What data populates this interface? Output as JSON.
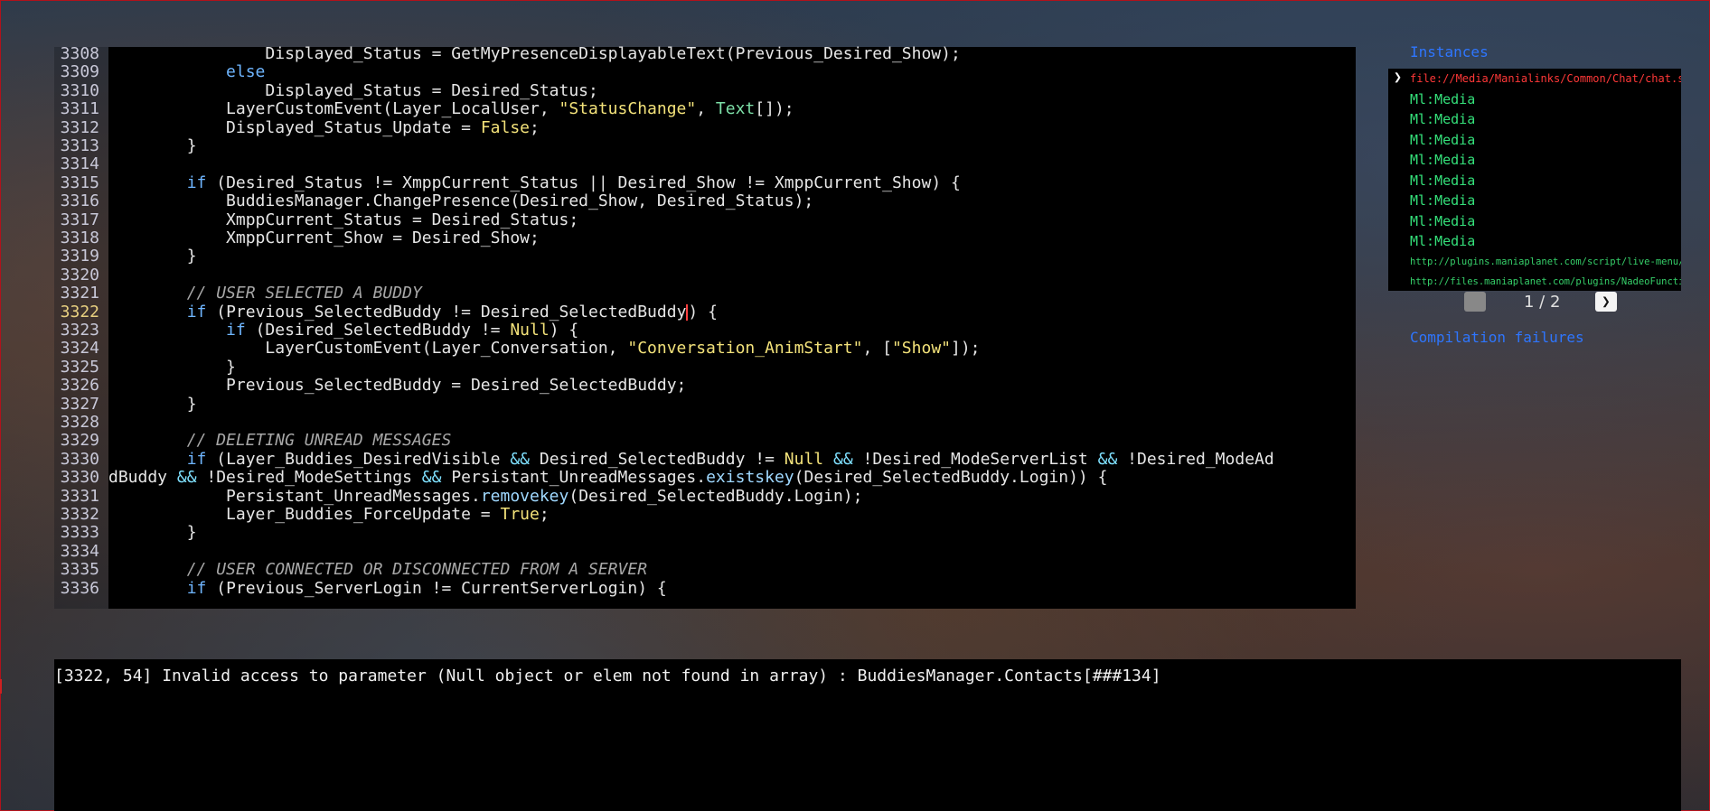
{
  "code": {
    "lines": [
      {
        "n": "3308",
        "segs": [
          {
            "t": "                Displayed_Status = GetMyPresenceDisplayableText(Previous_Desired_Show);",
            "c": "src"
          }
        ]
      },
      {
        "n": "3309",
        "segs": [
          {
            "t": "            ",
            "c": "src"
          },
          {
            "t": "else",
            "c": "kw"
          }
        ]
      },
      {
        "n": "3310",
        "segs": [
          {
            "t": "                Displayed_Status = Desired_Status;",
            "c": "src"
          }
        ]
      },
      {
        "n": "3311",
        "segs": [
          {
            "t": "            LayerCustomEvent(Layer_LocalUser, ",
            "c": "src"
          },
          {
            "t": "\"StatusChange\"",
            "c": "str"
          },
          {
            "t": ", ",
            "c": "src"
          },
          {
            "t": "Text",
            "c": "type"
          },
          {
            "t": "[]);",
            "c": "src"
          }
        ]
      },
      {
        "n": "3312",
        "segs": [
          {
            "t": "            Displayed_Status_Update = ",
            "c": "src"
          },
          {
            "t": "False",
            "c": "bool"
          },
          {
            "t": ";",
            "c": "src"
          }
        ]
      },
      {
        "n": "3313",
        "segs": [
          {
            "t": "        }",
            "c": "src"
          }
        ]
      },
      {
        "n": "3314",
        "segs": [
          {
            "t": "",
            "c": "src"
          }
        ]
      },
      {
        "n": "3315",
        "segs": [
          {
            "t": "        ",
            "c": "src"
          },
          {
            "t": "if",
            "c": "kw"
          },
          {
            "t": " (Desired_Status != XmppCurrent_Status || Desired_Show != XmppCurrent_Show) {",
            "c": "src"
          }
        ]
      },
      {
        "n": "3316",
        "segs": [
          {
            "t": "            BuddiesManager.ChangePresence(Desired_Show, Desired_Status);",
            "c": "src"
          }
        ]
      },
      {
        "n": "3317",
        "segs": [
          {
            "t": "            XmppCurrent_Status = Desired_Status;",
            "c": "src"
          }
        ]
      },
      {
        "n": "3318",
        "segs": [
          {
            "t": "            XmppCurrent_Show = Desired_Show;",
            "c": "src"
          }
        ]
      },
      {
        "n": "3319",
        "segs": [
          {
            "t": "        }",
            "c": "src"
          }
        ]
      },
      {
        "n": "3320",
        "segs": [
          {
            "t": "",
            "c": "src"
          }
        ]
      },
      {
        "n": "3321",
        "segs": [
          {
            "t": "        // USER SELECTED A BUDDY",
            "c": "cmt"
          }
        ]
      },
      {
        "n": "3322",
        "segs": [
          {
            "t": "        ",
            "c": "src"
          },
          {
            "t": "if",
            "c": "kw"
          },
          {
            "t": " (Previous_SelectedBuddy != Desired_SelectedBuddy",
            "c": "src"
          },
          {
            "t": "caret",
            "c": "caret"
          },
          {
            "t": ") {",
            "c": "src"
          }
        ]
      },
      {
        "n": "3323",
        "segs": [
          {
            "t": "            ",
            "c": "src"
          },
          {
            "t": "if",
            "c": "kw"
          },
          {
            "t": " (Desired_SelectedBuddy != ",
            "c": "src"
          },
          {
            "t": "Null",
            "c": "bool"
          },
          {
            "t": ") {",
            "c": "src"
          }
        ]
      },
      {
        "n": "3324",
        "segs": [
          {
            "t": "                LayerCustomEvent(Layer_Conversation, ",
            "c": "src"
          },
          {
            "t": "\"Conversation_AnimStart\"",
            "c": "str"
          },
          {
            "t": ", [",
            "c": "src"
          },
          {
            "t": "\"Show\"",
            "c": "str"
          },
          {
            "t": "]);",
            "c": "src"
          }
        ]
      },
      {
        "n": "3325",
        "segs": [
          {
            "t": "            }",
            "c": "src"
          }
        ]
      },
      {
        "n": "3326",
        "segs": [
          {
            "t": "            Previous_SelectedBuddy = Desired_SelectedBuddy;",
            "c": "src"
          }
        ]
      },
      {
        "n": "3327",
        "segs": [
          {
            "t": "        }",
            "c": "src"
          }
        ]
      },
      {
        "n": "3328",
        "segs": [
          {
            "t": "",
            "c": "src"
          }
        ]
      },
      {
        "n": "3329",
        "segs": [
          {
            "t": "        // DELETING UNREAD MESSAGES",
            "c": "cmt"
          }
        ]
      },
      {
        "n": "3330",
        "segs": [
          {
            "t": "        ",
            "c": "src"
          },
          {
            "t": "if",
            "c": "kw"
          },
          {
            "t": " (Layer_Buddies_DesiredVisible ",
            "c": "src"
          },
          {
            "t": "&&",
            "c": "op"
          },
          {
            "t": " Desired_SelectedBuddy != ",
            "c": "src"
          },
          {
            "t": "Null",
            "c": "bool"
          },
          {
            "t": " ",
            "c": "src"
          },
          {
            "t": "&&",
            "c": "op"
          },
          {
            "t": " !Desired_ModeServerList ",
            "c": "src"
          },
          {
            "t": "&&",
            "c": "op"
          },
          {
            "t": " !Desired_ModeAd",
            "c": "src"
          }
        ]
      },
      {
        "n": "3330",
        "segs": [
          {
            "t": "dBuddy ",
            "c": "src"
          },
          {
            "t": "&&",
            "c": "op"
          },
          {
            "t": " !Desired_ModeSettings ",
            "c": "src"
          },
          {
            "t": "&&",
            "c": "op"
          },
          {
            "t": " Persistant_UnreadMessages.",
            "c": "src"
          },
          {
            "t": "existskey",
            "c": "fn"
          },
          {
            "t": "(Desired_SelectedBuddy.Login)) {",
            "c": "src"
          }
        ],
        "wrap": true
      },
      {
        "n": "3331",
        "segs": [
          {
            "t": "            Persistant_UnreadMessages.",
            "c": "src"
          },
          {
            "t": "removekey",
            "c": "fn"
          },
          {
            "t": "(Desired_SelectedBuddy.Login);",
            "c": "src"
          }
        ]
      },
      {
        "n": "3332",
        "segs": [
          {
            "t": "            Layer_Buddies_ForceUpdate = ",
            "c": "src"
          },
          {
            "t": "True",
            "c": "bool"
          },
          {
            "t": ";",
            "c": "src"
          }
        ]
      },
      {
        "n": "3333",
        "segs": [
          {
            "t": "        }",
            "c": "src"
          }
        ]
      },
      {
        "n": "3334",
        "segs": [
          {
            "t": "",
            "c": "src"
          }
        ]
      },
      {
        "n": "3335",
        "segs": [
          {
            "t": "        // USER CONNECTED OR DISCONNECTED FROM A SERVER",
            "c": "cmt"
          }
        ]
      },
      {
        "n": "3336",
        "segs": [
          {
            "t": "        ",
            "c": "src"
          },
          {
            "t": "if",
            "c": "kw"
          },
          {
            "t": " (Previous_ServerLogin != CurrentServerLogin) {",
            "c": "src"
          }
        ]
      }
    ],
    "active_line": "3322"
  },
  "instances": {
    "title": "Instances",
    "selected_arrow": "❯",
    "items": [
      {
        "label": "file://Media/Manialinks/Common/Chat/chat.script.txt",
        "kind": "sel"
      },
      {
        "label": "Ml:Media",
        "kind": "ml"
      },
      {
        "label": "Ml:Media",
        "kind": "ml"
      },
      {
        "label": "Ml:Media",
        "kind": "ml"
      },
      {
        "label": "Ml:Media",
        "kind": "ml"
      },
      {
        "label": "Ml:Media",
        "kind": "ml"
      },
      {
        "label": "Ml:Media",
        "kind": "ml"
      },
      {
        "label": "Ml:Media",
        "kind": "ml"
      },
      {
        "label": "Ml:Media",
        "kind": "ml"
      },
      {
        "label": "http://plugins.maniaplanet.com/script/live-menu/?login=dreammyw",
        "kind": "url"
      },
      {
        "label": "http://files.maniaplanet.com/plugins/NadeoFunctions.Script.txt",
        "kind": "url"
      }
    ]
  },
  "pager": {
    "label": "1 / 2",
    "next_glyph": "❯"
  },
  "compilation_failures": "Compilation failures",
  "console": {
    "message": "[3322, 54] Invalid access to parameter (Null object or elem not found in array) : BuddiesManager.Contacts[###134]"
  },
  "colors": {
    "link_blue": "#2e76ff",
    "keyword": "#6fb6ff",
    "string": "#f3e27a",
    "error_red": "#ff3838",
    "instance_green": "#34e07a"
  }
}
